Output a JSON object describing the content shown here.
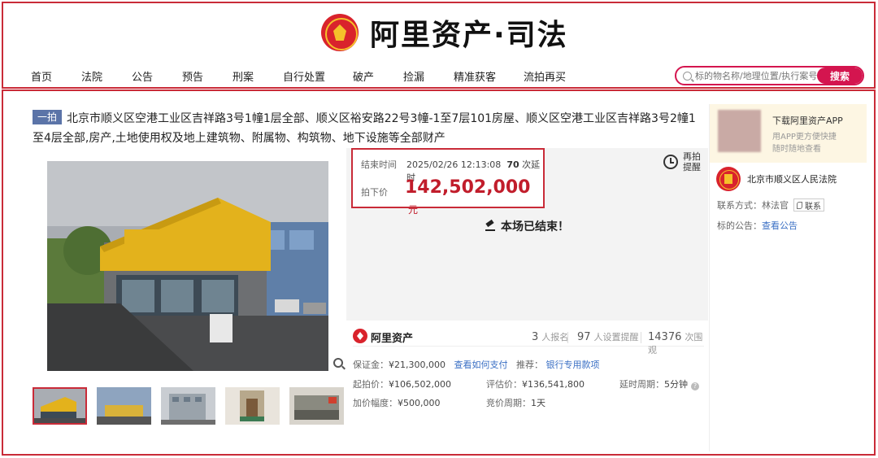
{
  "header": {
    "brand": "阿里资产·司法",
    "nav": [
      "首页",
      "法院",
      "公告",
      "预告",
      "刑案",
      "自行处置",
      "破产",
      "捡漏",
      "精准获客",
      "流拍再买"
    ],
    "search_placeholder": "标的物名称/地理位置/执行案号",
    "search_button": "搜索"
  },
  "item": {
    "tag": "一拍",
    "title": "北京市顺义区空港工业区吉祥路3号1幢1层全部、顺义区裕安路22号3幢-1至7层101房屋、顺义区空港工业区吉祥路3号2幢1至4层全部,房产,土地使用权及地上建筑物、附属物、构筑物、地下设施等全部财产"
  },
  "auction": {
    "end_label": "结束时间",
    "end_time": "2025/02/26 12:13:08",
    "extensions": "70",
    "extensions_label": "次延时",
    "price_label": "拍下价",
    "price": "142,502,000",
    "price_unit": "元",
    "remind_line1": "再拍",
    "remind_line2": "提醒",
    "status": "本场已结束！"
  },
  "info": {
    "brand": "阿里资产",
    "signups": "3",
    "signups_label": "人报名",
    "reminders": "97",
    "reminders_label": "人设置提醒",
    "views": "14376",
    "views_label": "次围观",
    "deposit_label": "保证金：",
    "deposit": "¥21,300,000",
    "deposit_link": "查看如何支付",
    "recommend_label": "推荐：",
    "recommend_link": "银行专用款项",
    "start_label": "起拍价：",
    "start_price": "¥106,502,000",
    "appraisal_label": "评估价：",
    "appraisal": "¥136,541,800",
    "delay_label": "延时周期：",
    "delay": "5分钟",
    "increment_label": "加价幅度：",
    "increment": "¥500,000",
    "cycle_label": "竞价周期：",
    "cycle": "1天"
  },
  "sidebar": {
    "app_title": "下载阿里资产APP",
    "app_sub1": "用APP更方便快捷",
    "app_sub2": "随时随地查看",
    "court": "北京市顺义区人民法院",
    "contact_label": "联系方式：",
    "contact_name": "林法官",
    "contact_button": "联系",
    "notice_label": "标的公告：",
    "notice_link": "查看公告"
  },
  "colors": {
    "accent": "#c92b38",
    "brand_red": "#d4154f",
    "tag_blue": "#5b74a8",
    "link": "#3a6fc4"
  }
}
